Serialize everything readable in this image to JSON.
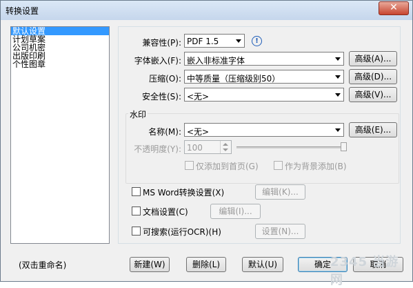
{
  "window": {
    "title": "转换设置",
    "close_label": "✕"
  },
  "profiles": {
    "items": [
      "默认设置",
      "计划草案",
      "公司机密",
      "出版印刷",
      "个性图章"
    ],
    "selected_index": 0,
    "hint": "(双击重命名)"
  },
  "settings": {
    "compatibility": {
      "label": "兼容性(P):",
      "value": "PDF 1.5",
      "info_icon": "info-icon"
    },
    "font_embed": {
      "label": "字体嵌入(F):",
      "value": "嵌入非标准字体",
      "advanced": "高级(A)..."
    },
    "compression": {
      "label": "压缩(O):",
      "value": "中等质量（压缩级别50）",
      "advanced": "高级(D)..."
    },
    "security": {
      "label": "安全性(S):",
      "value": "<无>",
      "advanced": "高级(V)..."
    }
  },
  "watermark": {
    "group_title": "水印",
    "name_label": "名称(M):",
    "name_value": "<无>",
    "advanced": "高级(E)...",
    "opacity_label": "不透明度(Y):",
    "opacity_value": "100",
    "opacity_level": 1.0,
    "first_page_only": "仅添加到首页(G)",
    "as_background": "作为背景添加(B)"
  },
  "options": {
    "ms_word": {
      "label": "MS Word转换设置(X)",
      "button": "编辑(K)..."
    },
    "doc_settings": {
      "label": "文档设置(C)",
      "button": "编辑(I)..."
    },
    "searchable": {
      "label": "可搜索(运行OCR)(H)",
      "button": "设置(N)..."
    }
  },
  "footer": {
    "new": "新建(W)",
    "delete": "删除(L)",
    "default": "默认(U)",
    "ok": "确定",
    "cancel": "取消"
  },
  "watermark_logo": "2345 当游网"
}
